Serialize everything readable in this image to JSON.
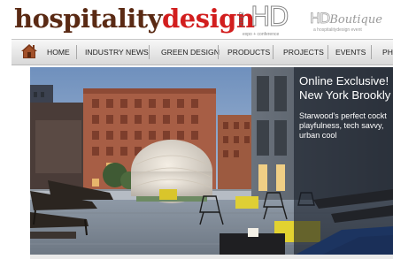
{
  "header": {
    "logo_part1": "hospitality",
    "logo_part2": "design",
    "hd_year": "2012",
    "hd_letters": "HD",
    "hd_subtitle": "expo + conference",
    "boutique_hd": "HD",
    "boutique_word": "Boutique",
    "boutique_subtitle": "a hospitalitydesign event"
  },
  "nav": {
    "items": [
      "HOME",
      "INDUSTRY NEWS",
      "GREEN DESIGN",
      "PRODUCTS",
      "PROJECTS",
      "EVENTS",
      "PHO"
    ]
  },
  "hero": {
    "title_line1": "Online Exclusive!",
    "title_line2": "New York Brookly",
    "text": "Starwood's perfect cockt\nplayfulness, tech savvy,\nurban cool"
  },
  "colors": {
    "logo_brown": "#5a2a14",
    "logo_red": "#d21e1e",
    "nav_text": "#222222"
  },
  "icons": {
    "home": "home-icon"
  }
}
